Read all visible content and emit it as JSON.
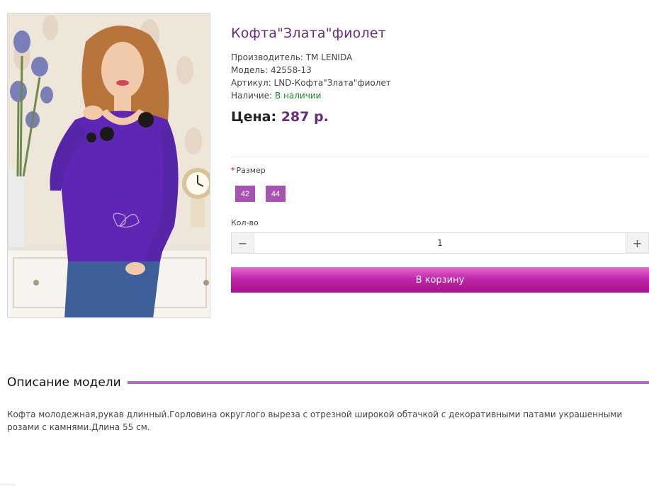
{
  "product": {
    "title": "Кофта\"Злата\"фиолет",
    "manufacturer_label": "Производитель:",
    "manufacturer": "ТМ LENIDA",
    "model_label": "Модель:",
    "model": "42558-13",
    "sku_label": "Артикул:",
    "sku": "LND-Кофта\"Злата\"фиолет",
    "availability_label": "Наличие:",
    "availability": "В наличии",
    "price_label": "Цена:",
    "price": "287 р."
  },
  "options": {
    "required_mark": "*",
    "size_label": "Размер",
    "sizes": [
      "42",
      "44"
    ]
  },
  "quantity": {
    "label": "Кол-во",
    "value": "1",
    "minus_symbol": "−",
    "plus_symbol": "+"
  },
  "cart": {
    "button_label": "В корзину"
  },
  "description": {
    "heading": "Описание модели",
    "text": "Кофта молодежная,рукав длинный.Горловина округлого выреза с отрезной широкой обтачкой с декоративными патами украшенными розами с камнями.Длина 55 см."
  },
  "colors": {
    "brand_purple": "#6b2b7a",
    "size_button": "#a653b4",
    "cart_button": "#c026a8",
    "in_stock": "#1b8a2a",
    "accent_line": "#b16bc0"
  }
}
